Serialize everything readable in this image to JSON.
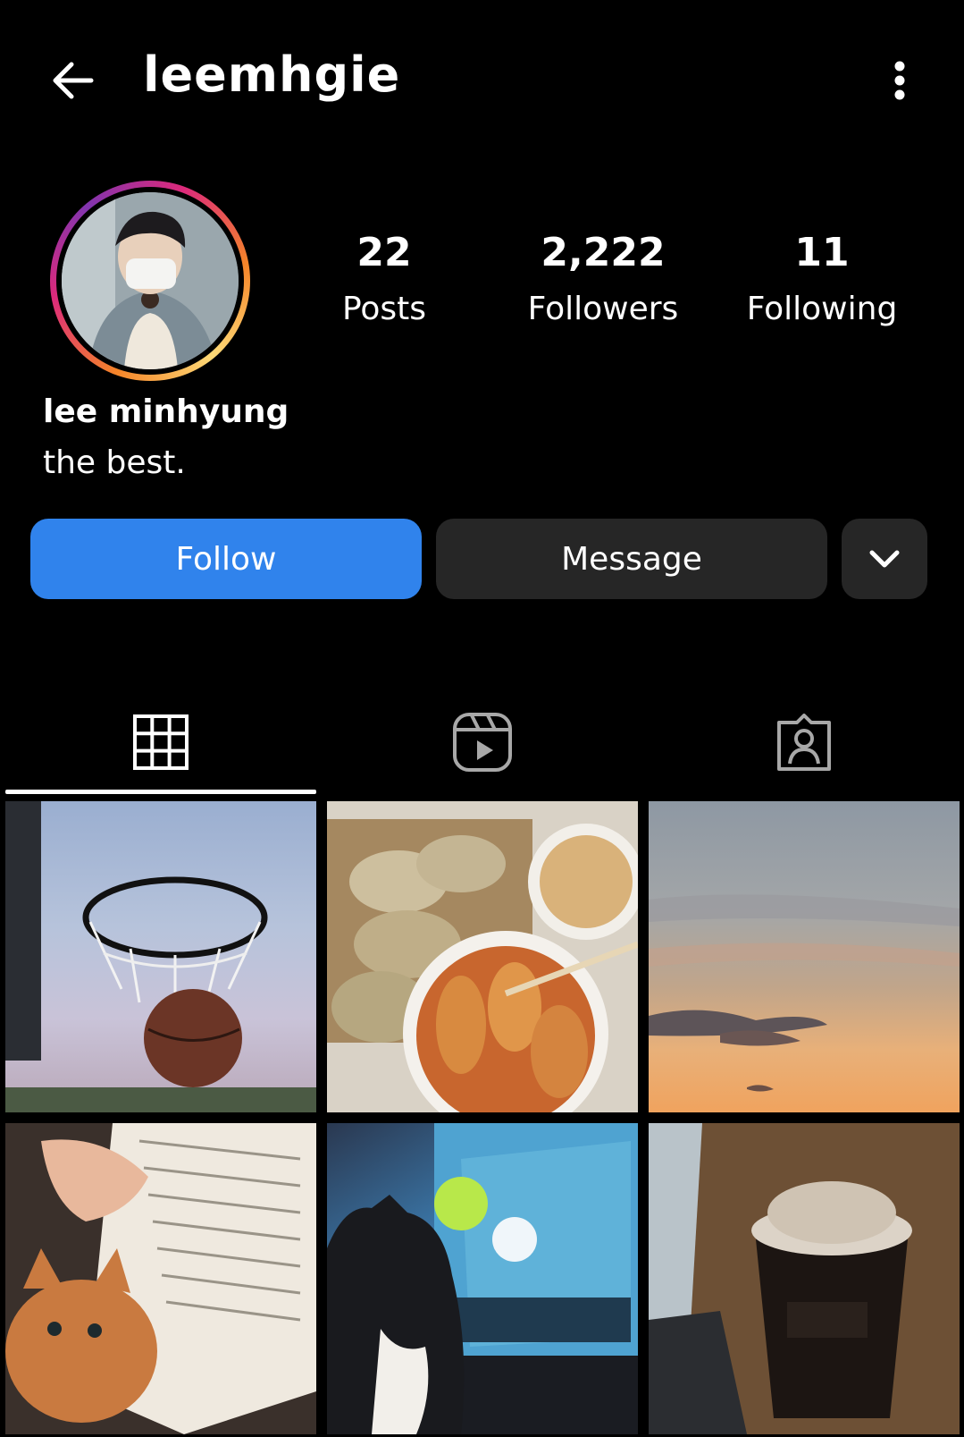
{
  "header": {
    "username": "leemhgie",
    "back_icon": "arrow-left-icon",
    "more_icon": "vertical-dots-icon"
  },
  "profile": {
    "stats": {
      "posts": {
        "value": "22",
        "label": "Posts"
      },
      "followers": {
        "value": "2,222",
        "label": "Followers"
      },
      "following": {
        "value": "11",
        "label": "Following"
      }
    },
    "name": "lee minhyung",
    "bio": "the best."
  },
  "actions": {
    "follow_label": "Follow",
    "message_label": "Message",
    "dropdown_icon": "chevron-down-icon"
  },
  "tabs": [
    {
      "icon": "grid-icon",
      "active": true
    },
    {
      "icon": "reels-icon",
      "active": false
    },
    {
      "icon": "tagged-icon",
      "active": false
    }
  ],
  "posts": [
    {
      "subject": "basketball-hoop"
    },
    {
      "subject": "dumplings-and-food"
    },
    {
      "subject": "sunset-sky"
    },
    {
      "subject": "kitten-with-book"
    },
    {
      "subject": "cat-watching-game"
    },
    {
      "subject": "iced-coffee-cup"
    }
  ],
  "colors": {
    "background": "#000000",
    "follow_button": "#3083ec",
    "secondary_button": "#262626"
  }
}
